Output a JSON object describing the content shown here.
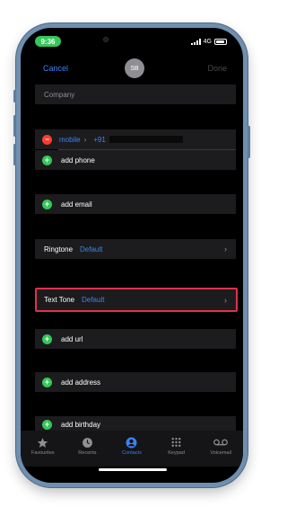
{
  "status": {
    "time": "9:36",
    "network": "4G"
  },
  "nav": {
    "cancel": "Cancel",
    "avatar_initials": "SB",
    "done": "Done"
  },
  "company_placeholder": "Company",
  "phone": {
    "type": "mobile",
    "number": "+91",
    "add_label": "add phone"
  },
  "email": {
    "add_label": "add email"
  },
  "ringtone": {
    "label": "Ringtone",
    "value": "Default"
  },
  "text_tone": {
    "label": "Text Tone",
    "value": "Default"
  },
  "url": {
    "add_label": "add url"
  },
  "address": {
    "add_label": "add address"
  },
  "birthday": {
    "add_label": "add birthday"
  },
  "tabs": [
    {
      "label": "Favourites",
      "icon": "star-icon"
    },
    {
      "label": "Recents",
      "icon": "clock-icon"
    },
    {
      "label": "Contacts",
      "icon": "person-icon",
      "active": true
    },
    {
      "label": "Keypad",
      "icon": "keypad-icon"
    },
    {
      "label": "Voicemail",
      "icon": "voicemail-icon"
    }
  ],
  "colors": {
    "accent": "#3b82f6",
    "add": "#35c759",
    "remove": "#ff3b30",
    "highlight": "#e0314d"
  }
}
